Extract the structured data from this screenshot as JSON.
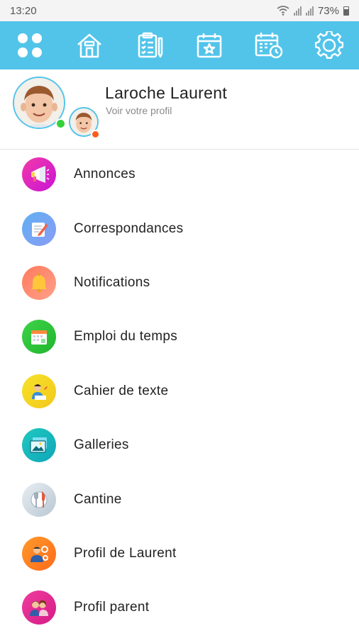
{
  "status_bar": {
    "time": "13:20",
    "battery": "73%"
  },
  "toolbar": {
    "buttons": [
      {
        "icon": "apps-grid-icon"
      },
      {
        "icon": "home-icon"
      },
      {
        "icon": "clipboard-checklist-icon"
      },
      {
        "icon": "calendar-star-icon"
      },
      {
        "icon": "calendar-clock-icon"
      },
      {
        "icon": "gear-icon"
      }
    ]
  },
  "profile": {
    "name": "Laroche Laurent",
    "subtitle": "Voir votre profil",
    "online_color": "#35d13a",
    "child_status_color": "#ff5a1a"
  },
  "menu": {
    "items": [
      {
        "label": "Annonces",
        "icon": "megaphone-icon"
      },
      {
        "label": "Correspondances",
        "icon": "notepad-pencil-icon"
      },
      {
        "label": "Notifications",
        "icon": "bell-icon"
      },
      {
        "label": "Emploi du temps",
        "icon": "calendar-icon"
      },
      {
        "label": "Cahier de texte",
        "icon": "student-writing-icon"
      },
      {
        "label": "Galleries",
        "icon": "gallery-icon"
      },
      {
        "label": "Cantine",
        "icon": "cutlery-icon"
      },
      {
        "label": "Profil de Laurent",
        "icon": "child-settings-icon"
      },
      {
        "label": "Profil parent",
        "icon": "parents-icon"
      }
    ]
  },
  "colors": {
    "accent": "#52c4ea"
  }
}
